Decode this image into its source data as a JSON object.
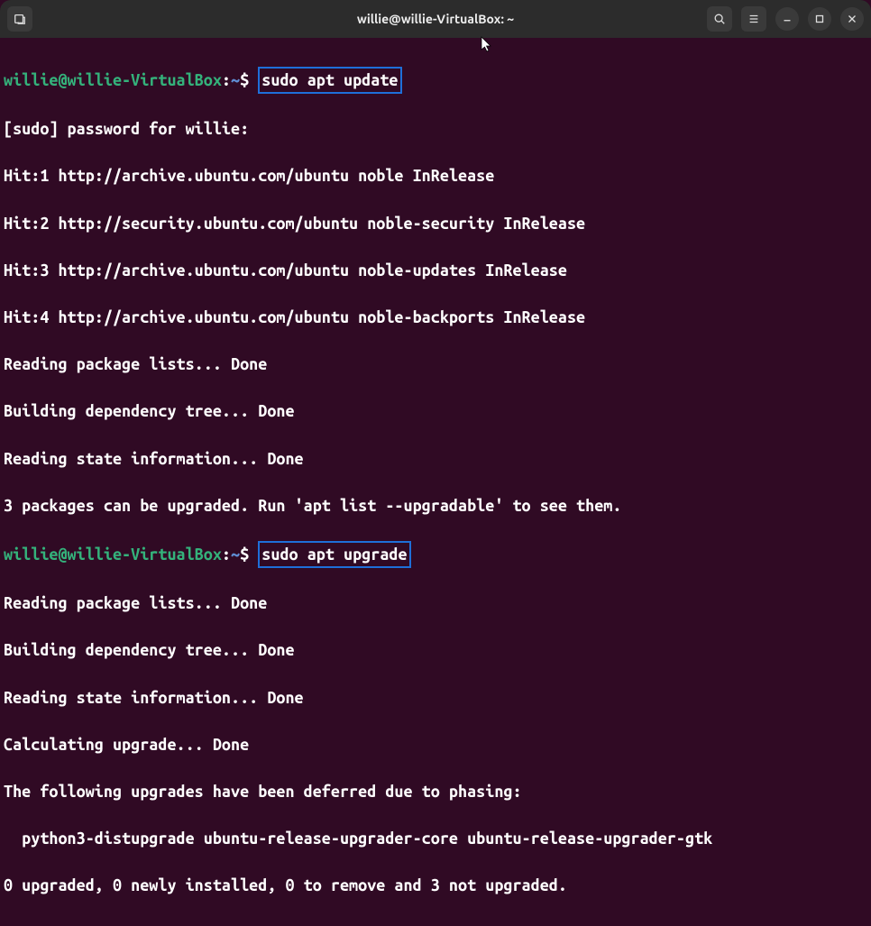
{
  "window": {
    "title": "willie@willie-VirtualBox: ~"
  },
  "prompt": {
    "userhost": "willie@willie-VirtualBox",
    "colon": ":",
    "path": "~",
    "dollar": "$"
  },
  "cmd1": "sudo apt update",
  "cmd2": "sudo apt upgrade",
  "lines": {
    "l1": "[sudo] password for willie: ",
    "l2": "Hit:1 http://archive.ubuntu.com/ubuntu noble InRelease",
    "l3": "Hit:2 http://security.ubuntu.com/ubuntu noble-security InRelease",
    "l4": "Hit:3 http://archive.ubuntu.com/ubuntu noble-updates InRelease",
    "l5": "Hit:4 http://archive.ubuntu.com/ubuntu noble-backports InRelease",
    "l6": "Reading package lists... Done",
    "l7": "Building dependency tree... Done",
    "l8": "Reading state information... Done",
    "l9": "3 packages can be upgraded. Run 'apt list --upgradable' to see them.",
    "l10": "Reading package lists... Done",
    "l11": "Building dependency tree... Done",
    "l12": "Reading state information... Done",
    "l13": "Calculating upgrade... Done",
    "l14": "The following upgrades have been deferred due to phasing:",
    "l15": "  python3-distupgrade ubuntu-release-upgrader-core ubuntu-release-upgrader-gtk",
    "l16": "0 upgraded, 0 newly installed, 0 to remove and 3 not upgraded."
  }
}
